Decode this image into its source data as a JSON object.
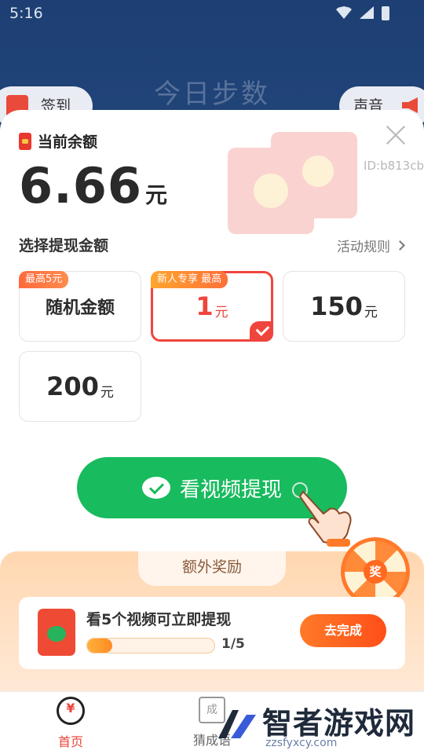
{
  "status_bar": {
    "time": "5:16"
  },
  "background_app": {
    "title": "今日步数",
    "left_pill": "签到",
    "right_pill": "声音"
  },
  "sheet": {
    "balance_label": "当前余额",
    "balance_amount": "6.66",
    "balance_unit": "元",
    "user_id": "ID:b813cb",
    "choose_label": "选择提现金额",
    "rules_link": "活动规则",
    "options": [
      {
        "tag": "最高5元",
        "text": "随机金额"
      },
      {
        "tag": "新人专享 最高",
        "value": "1",
        "unit": "元",
        "selected": true
      },
      {
        "value": "150",
        "unit": "元"
      },
      {
        "value": "200",
        "unit": "元"
      }
    ],
    "cta_label": "看视频提现"
  },
  "extra": {
    "tab_label": "额外奖励",
    "wheel_label": "奖",
    "task_title": "看5个视频可立即提现",
    "progress_text": "1/5",
    "progress_fraction": 0.2,
    "go_button": "去完成"
  },
  "nav": {
    "home": "首页",
    "idiom": "猜成语"
  },
  "watermark": {
    "title": "智者游戏网",
    "subtitle": "zzsfyxcy.com"
  },
  "colors": {
    "accent_red": "#f0453d",
    "cta_green": "#18bb5e",
    "orange": "#ff7a28"
  }
}
